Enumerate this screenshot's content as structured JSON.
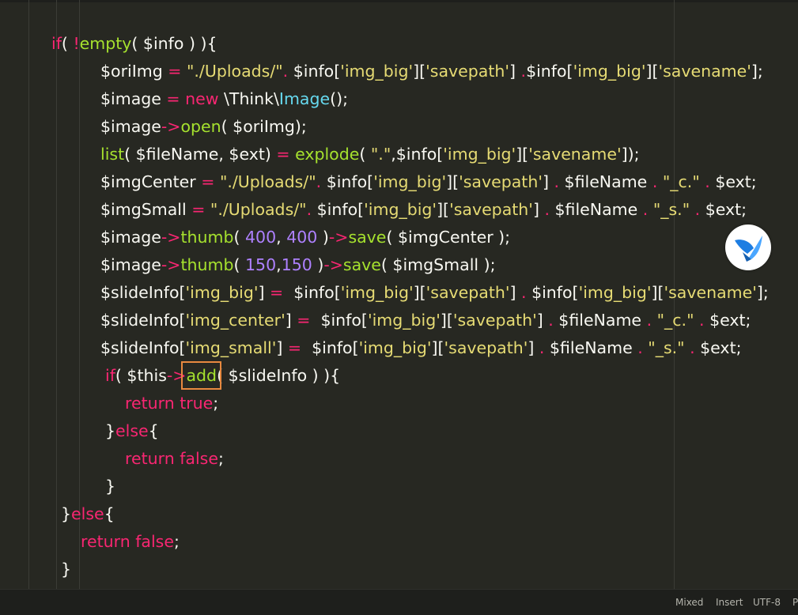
{
  "editor": {
    "lines": [
      [
        [
          "kw",
          "if"
        ],
        [
          "plain",
          "( "
        ],
        [
          "op",
          "!"
        ],
        [
          "fn",
          "empty"
        ],
        [
          "plain",
          "( $info ) ){"
        ]
      ],
      [
        [
          "var",
          "$oriImg "
        ],
        [
          "op",
          "= "
        ],
        [
          "str",
          "\"./Uploads/\""
        ],
        [
          "op",
          ". "
        ],
        [
          "var",
          "$info["
        ],
        [
          "str",
          "'img_big'"
        ],
        [
          "var",
          "]["
        ],
        [
          "str",
          "'savepath'"
        ],
        [
          "var",
          "] "
        ],
        [
          "op",
          "."
        ],
        [
          "var",
          "$info["
        ],
        [
          "str",
          "'img_big'"
        ],
        [
          "var",
          "]["
        ],
        [
          "str",
          "'savename'"
        ],
        [
          "var",
          "];"
        ]
      ],
      [
        [
          "var",
          "$image "
        ],
        [
          "op",
          "= "
        ],
        [
          "kw",
          "new "
        ],
        [
          "plain",
          "\\Think\\"
        ],
        [
          "class",
          "Image"
        ],
        [
          "plain",
          "();"
        ]
      ],
      [
        [
          "var",
          "$image"
        ],
        [
          "op",
          "->"
        ],
        [
          "fn",
          "open"
        ],
        [
          "plain",
          "( $oriImg);"
        ]
      ],
      [
        [
          "lang",
          "list"
        ],
        [
          "plain",
          "( $fileName, $ext) "
        ],
        [
          "op",
          "= "
        ],
        [
          "fn",
          "explode"
        ],
        [
          "plain",
          "( "
        ],
        [
          "str",
          "\".\""
        ],
        [
          "plain",
          ",$info["
        ],
        [
          "str",
          "'img_big'"
        ],
        [
          "plain",
          "]["
        ],
        [
          "str",
          "'savename'"
        ],
        [
          "plain",
          "]);"
        ]
      ],
      [
        [
          "var",
          "$imgCenter "
        ],
        [
          "op",
          "= "
        ],
        [
          "str",
          "\"./Uploads/\""
        ],
        [
          "op",
          ". "
        ],
        [
          "var",
          "$info["
        ],
        [
          "str",
          "'img_big'"
        ],
        [
          "var",
          "]["
        ],
        [
          "str",
          "'savepath'"
        ],
        [
          "var",
          "] "
        ],
        [
          "op",
          ". "
        ],
        [
          "var",
          "$fileName "
        ],
        [
          "op",
          ". "
        ],
        [
          "str",
          "\"_c.\" "
        ],
        [
          "op",
          ". "
        ],
        [
          "var",
          "$ext;"
        ]
      ],
      [
        [
          "var",
          "$imgSmall "
        ],
        [
          "op",
          "= "
        ],
        [
          "str",
          "\"./Uploads/\""
        ],
        [
          "op",
          ". "
        ],
        [
          "var",
          "$info["
        ],
        [
          "str",
          "'img_big'"
        ],
        [
          "var",
          "]["
        ],
        [
          "str",
          "'savepath'"
        ],
        [
          "var",
          "] "
        ],
        [
          "op",
          ". "
        ],
        [
          "var",
          "$fileName "
        ],
        [
          "op",
          ". "
        ],
        [
          "str",
          "\"_s.\" "
        ],
        [
          "op",
          ". "
        ],
        [
          "var",
          "$ext;"
        ]
      ],
      [
        [
          "var",
          "$image"
        ],
        [
          "op",
          "->"
        ],
        [
          "fn",
          "thumb"
        ],
        [
          "plain",
          "( "
        ],
        [
          "num",
          "400"
        ],
        [
          "plain",
          ", "
        ],
        [
          "num",
          "400"
        ],
        [
          "plain",
          " )"
        ],
        [
          "op",
          "->"
        ],
        [
          "fn",
          "save"
        ],
        [
          "plain",
          "( $imgCenter );"
        ]
      ],
      [
        [
          "var",
          "$image"
        ],
        [
          "op",
          "->"
        ],
        [
          "fn",
          "thumb"
        ],
        [
          "plain",
          "( "
        ],
        [
          "num",
          "150"
        ],
        [
          "plain",
          ","
        ],
        [
          "num",
          "150"
        ],
        [
          "plain",
          " )"
        ],
        [
          "op",
          "->"
        ],
        [
          "fn",
          "save"
        ],
        [
          "plain",
          "( $imgSmall );"
        ]
      ],
      [
        [
          "var",
          "$slideInfo["
        ],
        [
          "str",
          "'img_big'"
        ],
        [
          "var",
          "] "
        ],
        [
          "op",
          "= "
        ],
        [
          "var",
          " $info["
        ],
        [
          "str",
          "'img_big'"
        ],
        [
          "var",
          "]["
        ],
        [
          "str",
          "'savepath'"
        ],
        [
          "var",
          "] "
        ],
        [
          "op",
          ". "
        ],
        [
          "var",
          "$info["
        ],
        [
          "str",
          "'img_big'"
        ],
        [
          "var",
          "]["
        ],
        [
          "str",
          "'savename'"
        ],
        [
          "var",
          "];"
        ]
      ],
      [
        [
          "var",
          "$slideInfo["
        ],
        [
          "str",
          "'img_center'"
        ],
        [
          "var",
          "] "
        ],
        [
          "op",
          "= "
        ],
        [
          "var",
          " $info["
        ],
        [
          "str",
          "'img_big'"
        ],
        [
          "var",
          "]["
        ],
        [
          "str",
          "'savepath'"
        ],
        [
          "var",
          "] "
        ],
        [
          "op",
          ". "
        ],
        [
          "var",
          "$fileName "
        ],
        [
          "op",
          ". "
        ],
        [
          "str",
          "\"_c.\" "
        ],
        [
          "op",
          ". "
        ],
        [
          "var",
          "$ext;"
        ]
      ],
      [
        [
          "var",
          "$slideInfo["
        ],
        [
          "str",
          "'img_small'"
        ],
        [
          "var",
          "] "
        ],
        [
          "op",
          "= "
        ],
        [
          "var",
          " $info["
        ],
        [
          "str",
          "'img_big'"
        ],
        [
          "var",
          "]["
        ],
        [
          "str",
          "'savepath'"
        ],
        [
          "var",
          "] "
        ],
        [
          "op",
          ". "
        ],
        [
          "var",
          "$fileName "
        ],
        [
          "op",
          ". "
        ],
        [
          "str",
          "\"_s.\" "
        ],
        [
          "op",
          ". "
        ],
        [
          "var",
          "$ext;"
        ]
      ],
      [
        [
          "kw",
          "if"
        ],
        [
          "plain",
          "( $this"
        ],
        [
          "op",
          "->"
        ],
        [
          "fn",
          "add"
        ],
        [
          "plain",
          "( $slideInfo ) ){"
        ]
      ],
      [
        [
          "kw",
          "return "
        ],
        [
          "const",
          "true"
        ],
        [
          "plain",
          ";"
        ]
      ],
      [
        [
          "plain",
          "}"
        ],
        [
          "kw",
          "else"
        ],
        [
          "plain",
          "{"
        ]
      ],
      [
        [
          "kw",
          "return "
        ],
        [
          "const",
          "false"
        ],
        [
          "plain",
          ";"
        ]
      ],
      [
        [
          "plain",
          "}"
        ]
      ],
      [
        [
          "plain",
          "}"
        ],
        [
          "kw",
          "else"
        ],
        [
          "plain",
          "{"
        ]
      ],
      [
        [
          "kw",
          "return "
        ],
        [
          "const",
          "false"
        ],
        [
          "plain",
          ";"
        ]
      ],
      [
        [
          "plain",
          "}"
        ]
      ]
    ],
    "indent": [
      65,
      127,
      127,
      127,
      127,
      127,
      127,
      127,
      127,
      127,
      127,
      127,
      133,
      158,
      133,
      158,
      133,
      77,
      102,
      77
    ]
  },
  "statusbar": {
    "items": [
      "Mixed",
      "Insert",
      "UTF-8",
      "P"
    ]
  },
  "overlay": {
    "icon": "bird-logo-icon"
  },
  "colors": {
    "background": "#272822",
    "keyword": "#f92672",
    "function": "#a6e22e",
    "string": "#e6db74",
    "number": "#ae81ff",
    "class": "#66d9ef",
    "highlight_box": "#e8893f"
  }
}
